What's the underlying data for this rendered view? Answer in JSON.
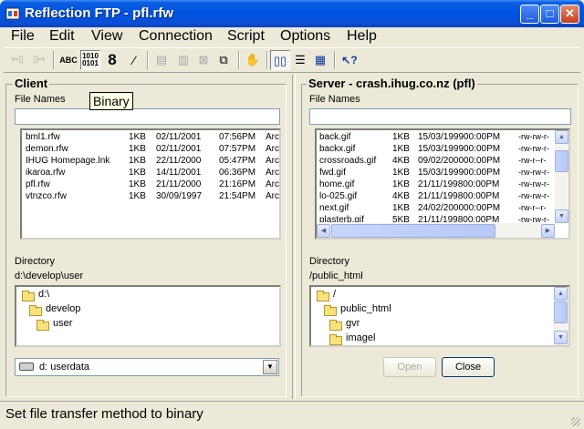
{
  "window": {
    "title": "Reflection FTP - pfl.rfw"
  },
  "menu": [
    "File",
    "Edit",
    "View",
    "Connection",
    "Script",
    "Options",
    "Help"
  ],
  "toolbar": {
    "abc": "ABC",
    "binary_top": "1010",
    "binary_bottom": "0101",
    "eight": "8",
    "help": "?"
  },
  "tooltip": "Binary",
  "client": {
    "title": "Client",
    "file_names_label": "File Names",
    "file_names_value": "",
    "files": [
      [
        "bml1.rfw",
        "1KB",
        "02/11/2001",
        "07:56PM",
        "Arc"
      ],
      [
        "demon.rfw",
        "1KB",
        "02/11/2001",
        "07:57PM",
        "Arc"
      ],
      [
        "IHUG Homepage.lnk",
        "1KB",
        "22/11/2000",
        "05:47PM",
        "Arc"
      ],
      [
        "ikaroa.rfw",
        "1KB",
        "14/11/2001",
        "06:36PM",
        "Arc"
      ],
      [
        "pfl.rfw",
        "1KB",
        "21/11/2000",
        "21:16PM",
        "Arc"
      ],
      [
        "vtnzco.rfw",
        "1KB",
        "30/09/1997",
        "21:54PM",
        "Arc"
      ]
    ],
    "directory_label": "Directory",
    "directory_path": "d:\\develop\\user",
    "tree": [
      "d:\\",
      "develop",
      "user"
    ],
    "drive": "d:  userdata"
  },
  "server": {
    "title": "Server - crash.ihug.co.nz (pfl)",
    "file_names_label": "File Names",
    "file_names_value": "",
    "files": [
      [
        "back.gif",
        "1KB",
        "15/03/199900:00PM",
        "-rw-rw-r-"
      ],
      [
        "backx.gif",
        "1KB",
        "15/03/199900:00PM",
        "-rw-rw-r-"
      ],
      [
        "crossroads.gif",
        "4KB",
        "09/02/200000:00PM",
        "-rw-r--r-"
      ],
      [
        "fwd.gif",
        "1KB",
        "15/03/199900:00PM",
        "-rw-rw-r-"
      ],
      [
        "home.gif",
        "1KB",
        "21/11/199800:00PM",
        "-rw-rw-r-"
      ],
      [
        "lo-025.gif",
        "4KB",
        "21/11/199800:00PM",
        "-rw-rw-r-"
      ],
      [
        "next.gif",
        "1KB",
        "24/02/200000:00PM",
        "-rw-r--r-"
      ],
      [
        "plasterb.gif",
        "5KB",
        "21/11/199800:00PM",
        "-rw-rw-r-"
      ]
    ],
    "directory_label": "Directory",
    "directory_path": "/public_html",
    "tree": [
      "/",
      "public_html",
      "gvr",
      "imagel"
    ]
  },
  "buttons": {
    "open": "Open",
    "close": "Close"
  },
  "status": "Set file transfer method to binary",
  "colors": {
    "titlebar": "#0053e1",
    "face": "#ece9d8",
    "tooltip": "#ffffe1"
  }
}
